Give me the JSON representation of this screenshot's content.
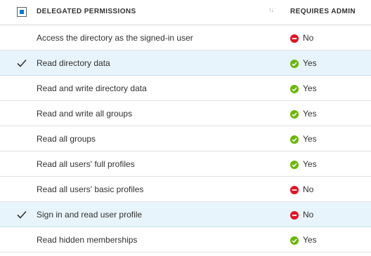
{
  "header": {
    "permission_label": "DELEGATED PERMISSIONS",
    "sort_glyph": "↑↓",
    "admin_label": "REQUIRES ADMIN"
  },
  "colors": {
    "yes": "#6bb700",
    "no": "#e81123",
    "selected_bg": "#e8f4fb",
    "accent": "#0078d4"
  },
  "rows": [
    {
      "permission": "Access the directory as the signed-in user",
      "requires_admin": "No",
      "selected": false
    },
    {
      "permission": "Read directory data",
      "requires_admin": "Yes",
      "selected": true
    },
    {
      "permission": "Read and write directory data",
      "requires_admin": "Yes",
      "selected": false
    },
    {
      "permission": "Read and write all groups",
      "requires_admin": "Yes",
      "selected": false
    },
    {
      "permission": "Read all groups",
      "requires_admin": "Yes",
      "selected": false
    },
    {
      "permission": "Read all users' full profiles",
      "requires_admin": "Yes",
      "selected": false
    },
    {
      "permission": "Read all users' basic profiles",
      "requires_admin": "No",
      "selected": false
    },
    {
      "permission": "Sign in and read user profile",
      "requires_admin": "No",
      "selected": true
    },
    {
      "permission": "Read hidden memberships",
      "requires_admin": "Yes",
      "selected": false
    }
  ]
}
